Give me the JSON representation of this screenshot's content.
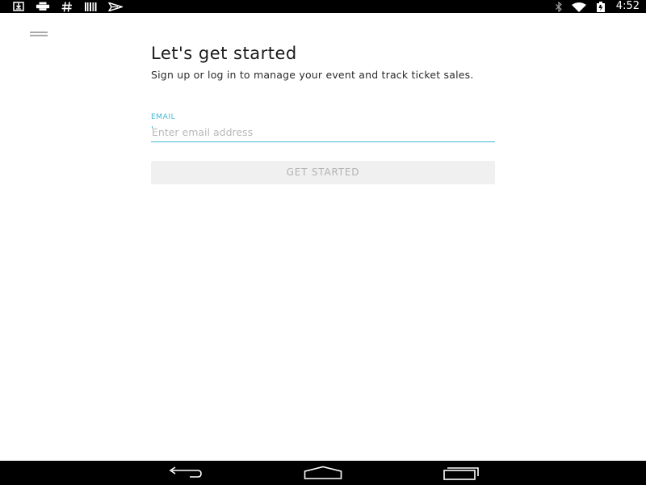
{
  "status_bar": {
    "left_icons": [
      "download-icon",
      "print-icon",
      "hash-icon",
      "barcode-icon",
      "send-icon"
    ],
    "right_icons": [
      "bluetooth-icon",
      "wifi-icon",
      "battery-icon"
    ],
    "time": "4:52"
  },
  "header": {
    "menu_icon": "hamburger-menu-icon"
  },
  "main": {
    "title": "Let's get started",
    "subtitle": "Sign up or log in to manage your event and track ticket sales.",
    "email": {
      "label": "EMAIL",
      "placeholder": "Enter email address",
      "value": ""
    },
    "cta_label": "GET STARTED"
  },
  "nav_bar": {
    "buttons": [
      "back-icon",
      "home-icon",
      "recents-icon"
    ]
  },
  "colors": {
    "accent": "#3eb7d3",
    "button_bg": "#f0f0f0",
    "button_text": "#b3b3b3",
    "title_text": "#1b1b1b",
    "status_bar_bg": "#000000"
  }
}
